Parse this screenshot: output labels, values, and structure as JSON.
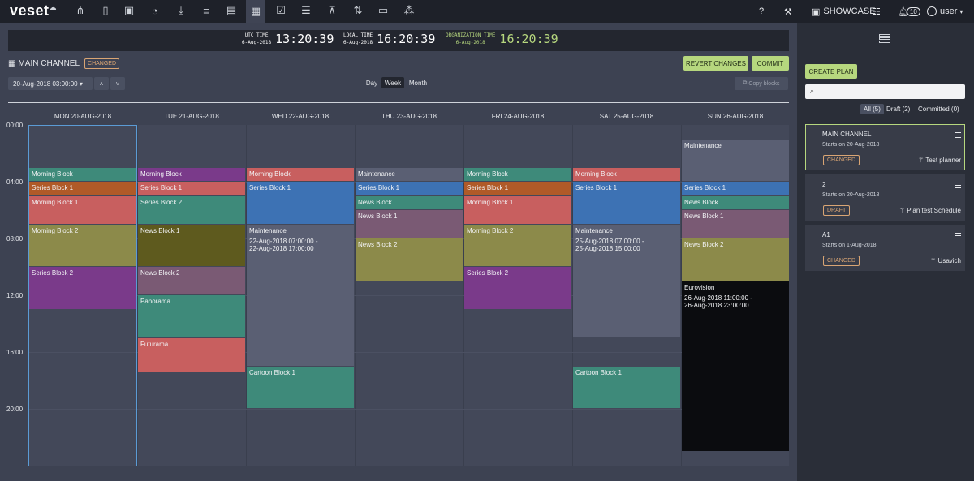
{
  "nav": {
    "logo": "veset",
    "showcase_label": "SHOWCASE",
    "notification_count": "10",
    "user_label": "user"
  },
  "clocks": {
    "utc_label_1": "UTC TIME",
    "utc_date": "6-Aug-2018",
    "utc_time": "13:20:39",
    "local_label_1": "LOCAL TIME",
    "local_date": "6-Aug-2018",
    "local_time": "16:20:39",
    "org_label_1": "ORGANIZATION TIME",
    "org_date": "6-Aug-2018",
    "org_time": "16:20:39"
  },
  "header": {
    "channel": "MAIN CHANNEL",
    "changed_badge": "CHANGED",
    "revert_label": "REVERT CHANGES",
    "commit_label": "COMMIT",
    "date_value": "20-Aug-2018 03:00:00 ▾",
    "prev_label": "˄",
    "next_label": "˅",
    "view_day": "Day",
    "view_week": "Week",
    "view_month": "Month",
    "copy_label": "Copy blocks"
  },
  "calendar": {
    "days": [
      "MON 20-AUG-2018",
      "TUE 21-AUG-2018",
      "WED 22-AUG-2018",
      "THU 23-AUG-2018",
      "FRI 24-AUG-2018",
      "SAT 25-AUG-2018",
      "SUN 26-AUG-2018"
    ],
    "time_labels": [
      "00:00",
      "04:00",
      "08:00",
      "12:00",
      "16:00",
      "20:00"
    ],
    "blocks": [
      {
        "day": 0,
        "start": 3.0,
        "end": 4.0,
        "label": "Morning Block",
        "color": "#3e8a7a"
      },
      {
        "day": 0,
        "start": 4.0,
        "end": 5.0,
        "label": "Series Block 1",
        "color": "#b05a28"
      },
      {
        "day": 0,
        "start": 5.0,
        "end": 7.0,
        "label": "Morning Block 1",
        "color": "#c85f5f"
      },
      {
        "day": 0,
        "start": 7.0,
        "end": 10.0,
        "label": "Morning Block 2",
        "color": "#8c8a4a"
      },
      {
        "day": 0,
        "start": 10.0,
        "end": 13.0,
        "label": "Series Block 2",
        "color": "#7a3a8a"
      },
      {
        "day": 1,
        "start": 3.0,
        "end": 4.0,
        "label": "Morning Block",
        "color": "#7a3a8a"
      },
      {
        "day": 1,
        "start": 4.0,
        "end": 5.0,
        "label": "Series Block 1",
        "color": "#c85f5f"
      },
      {
        "day": 1,
        "start": 5.0,
        "end": 7.0,
        "label": "Series Block 2",
        "color": "#3e8a7a"
      },
      {
        "day": 1,
        "start": 7.0,
        "end": 10.0,
        "label": "News Block 1",
        "color": "#5e5a1e"
      },
      {
        "day": 1,
        "start": 10.0,
        "end": 12.0,
        "label": "News Block 2",
        "color": "#7a5a74"
      },
      {
        "day": 1,
        "start": 12.0,
        "end": 15.0,
        "label": "Panorama",
        "color": "#3e8a7a"
      },
      {
        "day": 1,
        "start": 15.0,
        "end": 17.5,
        "label": "Futurama",
        "color": "#c85f5f"
      },
      {
        "day": 2,
        "start": 3.0,
        "end": 4.0,
        "label": "Morning Block",
        "color": "#c85f5f"
      },
      {
        "day": 2,
        "start": 4.0,
        "end": 7.0,
        "label": "Series Block 1",
        "color": "#3d72b4"
      },
      {
        "day": 2,
        "start": 7.0,
        "end": 17.0,
        "label": "Maintenance",
        "sub": "22-Aug-2018 07:00:00 -\n22-Aug-2018 17:00:00",
        "color": "#5a5f73"
      },
      {
        "day": 2,
        "start": 17.0,
        "end": 20.0,
        "label": "Cartoon Block 1",
        "color": "#3e8a7a"
      },
      {
        "day": 3,
        "start": 3.0,
        "end": 4.0,
        "label": "Maintenance",
        "color": "#5a5f73"
      },
      {
        "day": 3,
        "start": 4.0,
        "end": 5.0,
        "label": "Series Block 1",
        "color": "#3d72b4"
      },
      {
        "day": 3,
        "start": 5.0,
        "end": 6.0,
        "label": "News Block",
        "color": "#3e8a7a"
      },
      {
        "day": 3,
        "start": 6.0,
        "end": 8.0,
        "label": "News Block 1",
        "color": "#7a5a74"
      },
      {
        "day": 3,
        "start": 8.0,
        "end": 11.0,
        "label": "News Block 2",
        "color": "#8c8a4a"
      },
      {
        "day": 4,
        "start": 3.0,
        "end": 4.0,
        "label": "Morning Block",
        "color": "#3e8a7a"
      },
      {
        "day": 4,
        "start": 4.0,
        "end": 5.0,
        "label": "Series Block 1",
        "color": "#b05a28"
      },
      {
        "day": 4,
        "start": 5.0,
        "end": 7.0,
        "label": "Morning Block 1",
        "color": "#c85f5f"
      },
      {
        "day": 4,
        "start": 7.0,
        "end": 10.0,
        "label": "Morning Block 2",
        "color": "#8c8a4a"
      },
      {
        "day": 4,
        "start": 10.0,
        "end": 13.0,
        "label": "Series Block 2",
        "color": "#7a3a8a"
      },
      {
        "day": 5,
        "start": 3.0,
        "end": 4.0,
        "label": "Morning Block",
        "color": "#c85f5f"
      },
      {
        "day": 5,
        "start": 4.0,
        "end": 7.0,
        "label": "Series Block 1",
        "color": "#3d72b4"
      },
      {
        "day": 5,
        "start": 7.0,
        "end": 15.0,
        "label": "Maintenance",
        "sub": "25-Aug-2018 07:00:00 -\n25-Aug-2018 15:00:00",
        "color": "#5a5f73"
      },
      {
        "day": 5,
        "start": 17.0,
        "end": 20.0,
        "label": "Cartoon Block 1",
        "color": "#3e8a7a"
      },
      {
        "day": 6,
        "start": 1.0,
        "end": 4.0,
        "label": "Maintenance",
        "color": "#5a5f73"
      },
      {
        "day": 6,
        "start": 4.0,
        "end": 5.0,
        "label": "Series Block 1",
        "color": "#3d72b4"
      },
      {
        "day": 6,
        "start": 5.0,
        "end": 6.0,
        "label": "News Block",
        "color": "#3e8a7a"
      },
      {
        "day": 6,
        "start": 6.0,
        "end": 8.0,
        "label": "News Block 1",
        "color": "#7a5a74"
      },
      {
        "day": 6,
        "start": 8.0,
        "end": 11.0,
        "label": "News Block 2",
        "color": "#8c8a4a"
      },
      {
        "day": 6,
        "start": 11.0,
        "end": 23.0,
        "label": "Eurovision",
        "sub": "26-Aug-2018 11:00:00 -\n26-Aug-2018 23:00:00",
        "color": "#0b0c0f"
      }
    ]
  },
  "sidebar": {
    "create_plan": "CREATE PLAN",
    "search_placeholder": "",
    "tab_all": "All (5)",
    "tab_draft": "Draft (2)",
    "tab_committed": "Committed (0)",
    "plans": [
      {
        "name": "MAIN CHANNEL",
        "start": "Starts on 20-Aug-2018",
        "badge": "CHANGED",
        "owner": "Test planner"
      },
      {
        "name": "2",
        "start": "Starts on 20-Aug-2018",
        "badge": "DRAFT",
        "owner": "Plan test Schedule"
      },
      {
        "name": "A1",
        "start": "Starts on 1-Aug-2018",
        "badge": "CHANGED",
        "owner": "Usavich"
      }
    ]
  },
  "colors": {
    "accent_green": "#b6d77e",
    "changed_orange": "#d9a574",
    "today_outline": "#5b9bd5"
  }
}
